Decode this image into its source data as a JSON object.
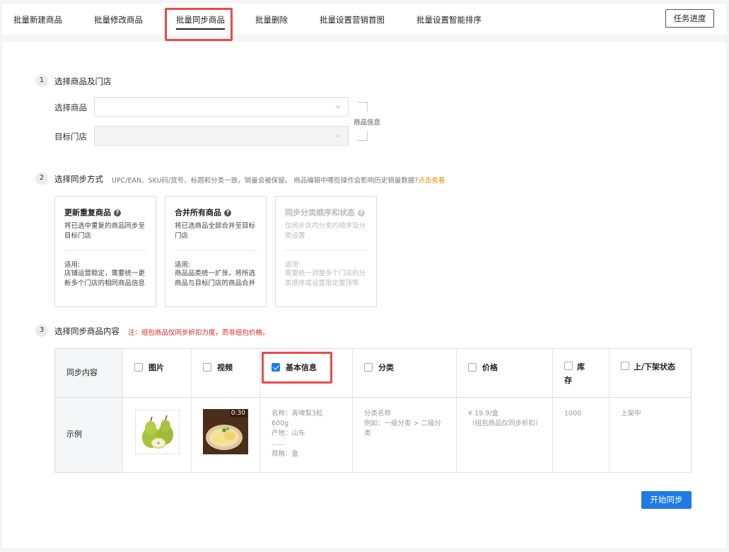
{
  "tabs": [
    {
      "label": "批量新建商品"
    },
    {
      "label": "批量修改商品"
    },
    {
      "label": "批量同步商品"
    },
    {
      "label": "批量删除"
    },
    {
      "label": "批量设置营销首图"
    },
    {
      "label": "批量设置智能排序"
    }
  ],
  "task_button": "任务进度",
  "step1": {
    "num": "1",
    "title": "选择商品及门店",
    "goods_label": "选择商品",
    "store_label": "目标门店",
    "side_label": "商品信息"
  },
  "step2": {
    "num": "2",
    "title": "选择同步方式",
    "hint": "UPC/EAN、SKU码/货号、标题和分类一致，销量会被保留。 商品编辑中哪些操作会影响历史销量数据?",
    "link": "点击查看",
    "cards": [
      {
        "title": "更新重复商品",
        "desc": "将已选中重复的商品同步至目标门店",
        "use_label": "适用:",
        "use_desc": "店铺运营稳定，需要统一更新多个门店的相同商品信息"
      },
      {
        "title": "合并所有商品",
        "desc": "将已选商品全部合并至目标门店",
        "use_label": "适用:",
        "use_desc": "商品品类统一扩张，将所选商品与目标门店的商品合并"
      },
      {
        "title": "同步分类顺序和状态",
        "desc": "仅同步店内分类的顺序及分类设置",
        "use_label": "适用:",
        "use_desc": "需要统一调整多个门店的分类顺序或设置限定置顶等"
      }
    ]
  },
  "step3": {
    "num": "3",
    "title": "选择同步商品内容",
    "note": "注：组包商品仅同步折扣力度，而非组包价格。",
    "row_header": "同步内容",
    "row_example": "示例",
    "columns": [
      {
        "label": "图片"
      },
      {
        "label": "视频"
      },
      {
        "label": "基本信息"
      },
      {
        "label": "分类"
      },
      {
        "label": "价格"
      },
      {
        "label": "库存"
      },
      {
        "label": "上/下架状态"
      }
    ],
    "video_duration": "0:30",
    "examples": {
      "basic_name": "名称：青啤梨3粒600g",
      "basic_origin": "产地：山东",
      "basic_more": "……",
      "basic_spec": "规格：盒",
      "cat_name": "分类名称",
      "cat_example": "例如：一级分类 > 二级分类",
      "price_value": "¥ 19.9/盒",
      "price_note": "（组包商品仅同步折扣）",
      "stock_value": "1000",
      "status_value": "上架中"
    }
  },
  "start_button": "开始同步",
  "colors": {
    "primary": "#1f7ae6",
    "highlight": "#e94b4b",
    "note": "#e02020",
    "link": "#f08c00"
  }
}
